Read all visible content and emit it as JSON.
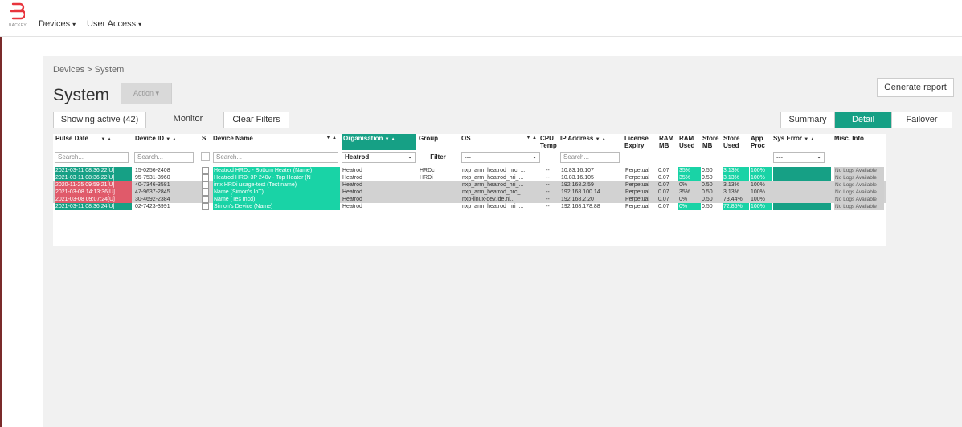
{
  "topbar": {
    "brand": "BACKEY",
    "nav": [
      {
        "label": "Devices",
        "caret": "▾"
      },
      {
        "label": "User Access",
        "caret": "▾"
      }
    ]
  },
  "breadcrumb": "Devices > System",
  "page": {
    "title": "System",
    "action_label": "Action",
    "action_caret": "▾",
    "generate_report": "Generate report"
  },
  "filters": {
    "showing_active": "Showing active (42)",
    "monitor": "Monitor",
    "clear_filters": "Clear Filters"
  },
  "views": {
    "summary": "Summary",
    "detail": "Detail",
    "failover": "Failover"
  },
  "table": {
    "headers": {
      "pulse_date": "Pulse Date",
      "device_id": "Device ID",
      "s": "S",
      "device_name": "Device Name",
      "organisation": "Organisation",
      "group": "Group",
      "os": "OS",
      "cpu_temp": "CPU Temp",
      "ip_address": "IP Address",
      "license_expiry": "License Expiry",
      "ram_mb": "RAM MB",
      "ram_used": "RAM Used",
      "store_mb": "Store MB",
      "store_used": "Store Used",
      "app_proc": "App Proc",
      "sys_error": "Sys Error",
      "misc_info": "Misc. Info"
    },
    "sort_arrows": "▼ ▲",
    "filters": {
      "search_placeholder": "Search...",
      "organisation_value": "Heatrod",
      "group_button": "Filter",
      "os_value": "---",
      "sys_error_value": "---",
      "dropdown_glyph": "⌄"
    },
    "rows": [
      {
        "pulse_date": "2021-03-11 08:36:22[U]",
        "pulse_status": "green",
        "device_id": "15-0256-2408",
        "device_name": "Heatrod HRDc - Bottom Heater (Name)",
        "organisation": "Heatrod",
        "group": "HRDc",
        "os": "nxp_arm_heatrod_hrc_...",
        "cpu_temp": "--",
        "ip": "10.83.16.107",
        "license": "Perpetual",
        "ram_mb": "0.07",
        "ram_used": "35%",
        "ram_hl": true,
        "store_mb": "0.50",
        "store_used": "3.13%",
        "store_hl": true,
        "app_proc": "100%",
        "app_hl": true,
        "sys_hl": true,
        "misc": "No Logs Available",
        "row_grey": false
      },
      {
        "pulse_date": "2021-03-11 08:36:22[U]",
        "pulse_status": "green",
        "device_id": "95-7531-3960",
        "device_name": "Heatrod HRDi 3P 240v - Top Heater (N",
        "organisation": "Heatrod",
        "group": "HRDi",
        "os": "nxp_arm_heatrod_hri_...",
        "cpu_temp": "--",
        "ip": "10.83.16.105",
        "license": "Perpetual",
        "ram_mb": "0.07",
        "ram_used": "35%",
        "ram_hl": true,
        "store_mb": "0.50",
        "store_used": "3.13%",
        "store_hl": true,
        "app_proc": "100%",
        "app_hl": true,
        "sys_hl": true,
        "misc": "No Logs Available",
        "row_grey": false
      },
      {
        "pulse_date": "2020-11-25 09:59:21[U]",
        "pulse_status": "red",
        "device_id": "40-7346-3581",
        "device_name": "imx HRDi usage-test (Test name)",
        "organisation": "Heatrod",
        "group": "",
        "os": "nxp_arm_heatrod_hri_...",
        "cpu_temp": "--",
        "ip": "192.168.2.59",
        "license": "Perpetual",
        "ram_mb": "0.07",
        "ram_used": "0%",
        "ram_hl": false,
        "store_mb": "0.50",
        "store_used": "3.13%",
        "store_hl": false,
        "app_proc": "100%",
        "app_hl": false,
        "sys_hl": false,
        "misc": "No Logs Available",
        "row_grey": true
      },
      {
        "pulse_date": "2021-03-08 14:13:36[U]",
        "pulse_status": "red",
        "device_id": "47-9637-2845",
        "device_name": "Name (Simon's IoT)",
        "organisation": "Heatrod",
        "group": "",
        "os": "nxp_arm_heatrod_hrc_...",
        "cpu_temp": "--",
        "ip": "192.168.100.14",
        "license": "Perpetual",
        "ram_mb": "0.07",
        "ram_used": "35%",
        "ram_hl": false,
        "store_mb": "0.50",
        "store_used": "3.13%",
        "store_hl": false,
        "app_proc": "100%",
        "app_hl": false,
        "sys_hl": false,
        "misc": "No Logs Available",
        "row_grey": true
      },
      {
        "pulse_date": "2021-03-08 09:07:24[U]",
        "pulse_status": "red",
        "device_id": "30-4692-2384",
        "device_name": "Name (Tes mcd)",
        "organisation": "Heatrod",
        "group": "",
        "os": "nxp-linux-dev.ide.ni...",
        "cpu_temp": "--",
        "ip": "192.168.2.20",
        "license": "Perpetual",
        "ram_mb": "0.07",
        "ram_used": "0%",
        "ram_hl": false,
        "store_mb": "0.50",
        "store_used": "73.44%",
        "store_hl": false,
        "app_proc": "100%",
        "app_hl": false,
        "sys_hl": false,
        "misc": "No Logs Available",
        "row_grey": true
      },
      {
        "pulse_date": "2021-03-11 08:36:24[U]",
        "pulse_status": "green",
        "device_id": "02-7423-3991",
        "device_name": "Simon's Device (Name)",
        "organisation": "Heatrod",
        "group": "",
        "os": "nxp_arm_heatrod_hri_...",
        "cpu_temp": "--",
        "ip": "192.168.178.88",
        "license": "Perpetual",
        "ram_mb": "0.07",
        "ram_used": "0%",
        "ram_hl": true,
        "store_mb": "0.50",
        "store_used": "72.85%",
        "store_hl": true,
        "app_proc": "100%",
        "app_hl": true,
        "sys_hl": true,
        "misc": "No Logs Available",
        "row_grey": false
      }
    ]
  },
  "colors": {
    "accent": "#16a085",
    "teal_bright": "#19d3a6",
    "status_red": "#e05a6a",
    "logo_red": "#e8343c"
  }
}
